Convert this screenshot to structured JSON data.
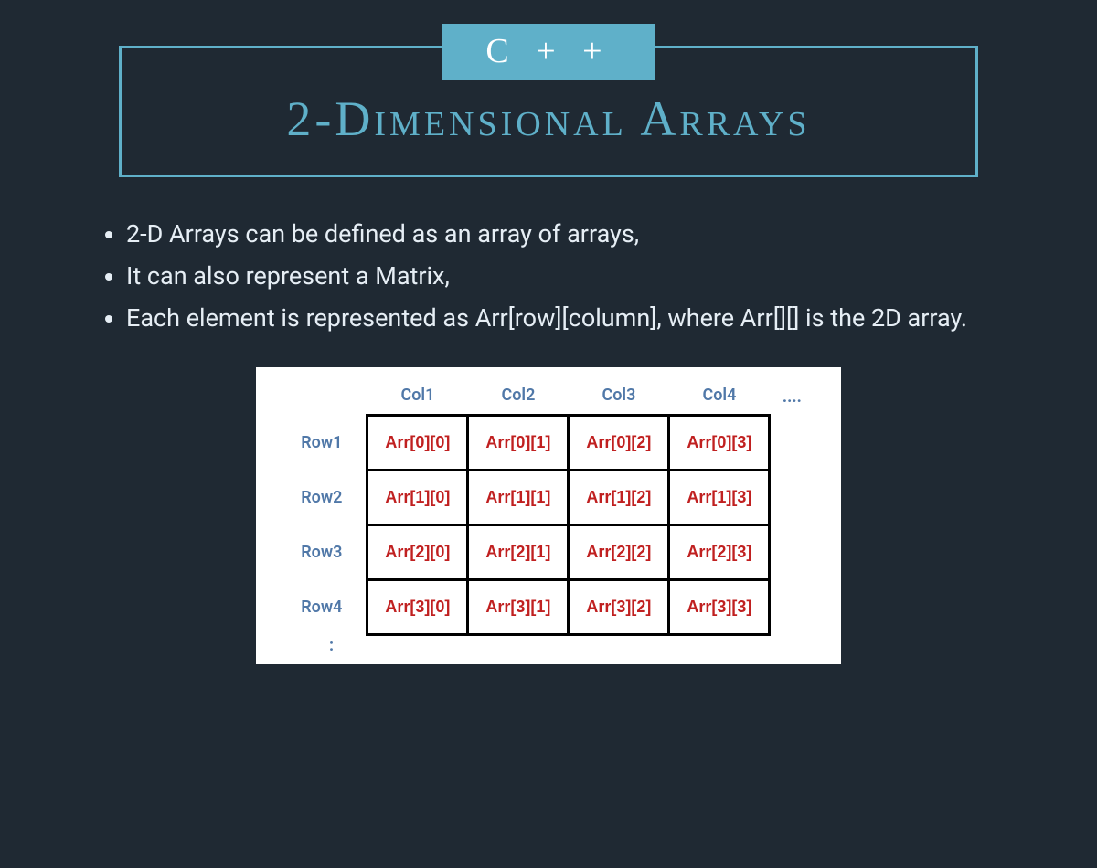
{
  "header": {
    "badge": "C  +  +",
    "title": "2-Dimensional Arrays"
  },
  "bullets": [
    "2-D Arrays can be defined as an array of arrays,",
    "It can also represent a Matrix,",
    "Each element is represented as Arr[row][column], where Arr[][] is the 2D array."
  ],
  "diagram": {
    "col_headers": [
      "Col1",
      "Col2",
      "Col3",
      "Col4"
    ],
    "col_ellipsis": "....",
    "row_headers": [
      "Row1",
      "Row2",
      "Row3",
      "Row4"
    ],
    "row_ellipsis": ":",
    "cells": [
      [
        "Arr[0][0]",
        "Arr[0][1]",
        "Arr[0][2]",
        "Arr[0][3]"
      ],
      [
        "Arr[1][0]",
        "Arr[1][1]",
        "Arr[1][2]",
        "Arr[1][3]"
      ],
      [
        "Arr[2][0]",
        "Arr[2][1]",
        "Arr[2][2]",
        "Arr[2][3]"
      ],
      [
        "Arr[3][0]",
        "Arr[3][1]",
        "Arr[3][2]",
        "Arr[3][3]"
      ]
    ]
  }
}
